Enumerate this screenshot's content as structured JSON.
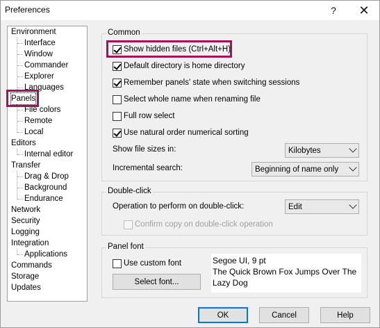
{
  "window": {
    "title": "Preferences",
    "help_glyph": "?",
    "close_glyph": "✕"
  },
  "tree": {
    "items": [
      {
        "label": "Environment"
      },
      {
        "label": "Interface"
      },
      {
        "label": "Window"
      },
      {
        "label": "Commander"
      },
      {
        "label": "Explorer"
      },
      {
        "label": "Languages"
      },
      {
        "label": "Panels"
      },
      {
        "label": "File colors"
      },
      {
        "label": "Remote"
      },
      {
        "label": "Local"
      },
      {
        "label": "Editors"
      },
      {
        "label": "Internal editor"
      },
      {
        "label": "Transfer"
      },
      {
        "label": "Drag & Drop"
      },
      {
        "label": "Background"
      },
      {
        "label": "Endurance"
      },
      {
        "label": "Network"
      },
      {
        "label": "Security"
      },
      {
        "label": "Logging"
      },
      {
        "label": "Integration"
      },
      {
        "label": "Applications"
      },
      {
        "label": "Commands"
      },
      {
        "label": "Storage"
      },
      {
        "label": "Updates"
      }
    ],
    "selected": "Panels"
  },
  "common": {
    "title": "Common",
    "show_hidden": {
      "label": "Show hidden files (Ctrl+Alt+H)",
      "checked": true
    },
    "default_home": {
      "label": "Default directory is home directory",
      "checked": true
    },
    "remember_state": {
      "label": "Remember panels' state when switching sessions",
      "checked": true
    },
    "select_whole_name": {
      "label": "Select whole name when renaming file",
      "checked": false
    },
    "full_row": {
      "label": "Full row select",
      "checked": false
    },
    "natural_order": {
      "label": "Use natural order numerical sorting",
      "checked": true
    },
    "file_sizes_label": "Show file sizes in:",
    "file_sizes_value": "Kilobytes",
    "incremental_label": "Incremental search:",
    "incremental_value": "Beginning of name only"
  },
  "double_click": {
    "title": "Double-click",
    "operation_label": "Operation to perform on double-click:",
    "operation_value": "Edit",
    "confirm_copy": {
      "label": "Confirm copy on double-click operation",
      "checked": false,
      "disabled": true
    }
  },
  "panel_font": {
    "title": "Panel font",
    "use_custom": {
      "label": "Use custom font",
      "checked": false
    },
    "select_button": "Select font...",
    "font_name": "Segoe UI, 9 pt",
    "sample_text": "The Quick Brown Fox Jumps Over The Lazy Dog"
  },
  "buttons": {
    "ok": "OK",
    "cancel": "Cancel",
    "help": "Help"
  },
  "colors": {
    "highlight": "#a3125c",
    "default_button_border": "#0078d7"
  }
}
